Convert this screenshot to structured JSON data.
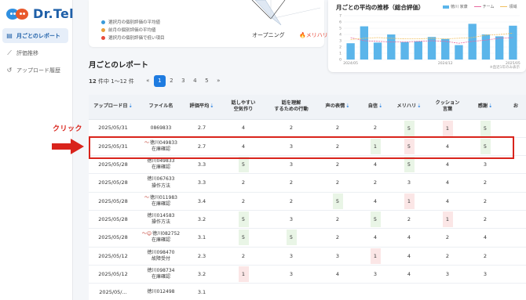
{
  "app": {
    "brand": "Dr.Tel"
  },
  "sidebar": {
    "items": [
      {
        "icon": "document-icon",
        "label": "月ごとのレポート",
        "active": true
      },
      {
        "icon": "trend-icon",
        "label": "評価推移",
        "active": false
      },
      {
        "icon": "history-icon",
        "label": "アップロード履歴",
        "active": false
      }
    ]
  },
  "top_card": {
    "legend": [
      {
        "color": "#3a9ad9",
        "text": "選択月の個別評価の平均値"
      },
      {
        "color": "#e8a03a",
        "text": "前月の個別評価の平均値"
      },
      {
        "color": "#e84a3a",
        "text": "選択月の個別評価で低い項目"
      }
    ],
    "radar_label_1": "オープニング",
    "radar_label_2": "メリハリ"
  },
  "trend_chart": {
    "title": "月ごとの平均の推移（総合評価）",
    "legend": {
      "self": "徳川 家康",
      "team": "チーム",
      "all": "領域"
    },
    "note": "※直近1年のみ表示",
    "colors": {
      "bar": "#5bb5ea",
      "team": "#e86aa0",
      "all": "#f0c060"
    }
  },
  "chart_data": {
    "type": "bar",
    "title": "月ごとの平均の推移（総合評価）",
    "x": [
      "2024/05",
      "2024/06",
      "2024/07",
      "2024/08",
      "2024/09",
      "2024/10",
      "2024/11",
      "2024/12",
      "2025/01",
      "2025/02",
      "2025/03",
      "2025/04",
      "2025/05"
    ],
    "tick_labels": [
      "2024/05",
      "2024/12",
      "2025/05"
    ],
    "ylim": [
      0,
      7
    ],
    "yticks": [
      0,
      1,
      2,
      3,
      4,
      5,
      6,
      7
    ],
    "series": [
      {
        "name": "徳川 家康",
        "type": "bar",
        "values": [
          2.6,
          5.3,
          2.7,
          4.0,
          2.8,
          2.9,
          3.6,
          3.3,
          2.3,
          5.7,
          4.0,
          3.7,
          5.4
        ]
      },
      {
        "name": "チーム",
        "type": "line",
        "values": [
          3.5,
          3.0,
          2.9,
          2.8,
          2.8,
          2.9,
          3.0,
          2.9,
          2.6,
          2.9,
          3.1,
          3.4,
          3.5
        ]
      },
      {
        "name": "領域",
        "type": "line",
        "values": [
          3.2,
          3.4,
          3.5,
          3.4,
          3.3,
          3.3,
          3.4,
          3.3,
          3.4,
          3.5,
          3.9,
          4.0,
          4.2
        ]
      }
    ]
  },
  "main": {
    "title": "月ごとのレポート",
    "pager": {
      "count_bold": "12",
      "count_rest": " 件中 1〜12 件",
      "prev": "«",
      "pages": [
        "1",
        "2",
        "3",
        "4",
        "5"
      ],
      "next": "»",
      "active": "1"
    },
    "columns": [
      [
        "アップロード日",
        "⇣"
      ],
      [
        "ファイル名",
        ""
      ],
      [
        "評価平均",
        "⇣"
      ],
      [
        "話しやすい",
        "空気作り"
      ],
      [
        "話を理解",
        "するための行動"
      ],
      [
        "声の表情",
        "⇣"
      ],
      [
        "自信",
        "⇣"
      ],
      [
        "メリハリ",
        "⇣"
      ],
      [
        "クッション",
        "言葉"
      ],
      [
        "感謝",
        "⇣"
      ],
      [
        "お",
        ""
      ]
    ],
    "rows": [
      {
        "date": "2025/05/31",
        "file": [
          "0869833"
        ],
        "mark": "",
        "avg": "2.7",
        "v": [
          "4",
          "2",
          "2",
          "2",
          "5",
          "1",
          "5",
          ""
        ],
        "c": [
          "",
          "",
          "",
          "",
          "g",
          "r",
          "g",
          ""
        ]
      },
      {
        "date": "2025/05/31",
        "file": [
          "徳川049833",
          "在庫確認"
        ],
        "mark": "〜",
        "avg": "2.7",
        "v": [
          "4",
          "3",
          "2",
          "1",
          "5",
          "4",
          "5",
          ""
        ],
        "c": [
          "",
          "",
          "",
          "g",
          "r",
          "",
          "g",
          ""
        ]
      },
      {
        "date": "2025/05/28",
        "file": [
          "徳川049833",
          "在庫確認"
        ],
        "mark": "",
        "avg": "3.3",
        "v": [
          "5",
          "3",
          "2",
          "4",
          "5",
          "4",
          "3",
          ""
        ],
        "c": [
          "g",
          "",
          "",
          "",
          "g",
          "",
          "",
          ""
        ]
      },
      {
        "date": "2025/05/28",
        "file": [
          "徳川067633",
          "操作方法"
        ],
        "mark": "",
        "avg": "3.3",
        "v": [
          "2",
          "2",
          "2",
          "2",
          "3",
          "4",
          "2",
          ""
        ],
        "c": [
          "",
          "",
          "",
          "",
          "",
          "",
          "",
          ""
        ]
      },
      {
        "date": "2025/05/28",
        "file": [
          "徳川011983",
          "在庫確認"
        ],
        "mark": "〜",
        "avg": "3.4",
        "v": [
          "2",
          "2",
          "5",
          "4",
          "1",
          "4",
          "2",
          ""
        ],
        "c": [
          "",
          "",
          "g",
          "",
          "r",
          "",
          "",
          ""
        ]
      },
      {
        "date": "2025/05/28",
        "file": [
          "徳川014583",
          "操作方法"
        ],
        "mark": "",
        "avg": "3.2",
        "v": [
          "5",
          "3",
          "2",
          "5",
          "2",
          "1",
          "2",
          ""
        ],
        "c": [
          "g",
          "",
          "",
          "g",
          "",
          "r",
          "",
          ""
        ]
      },
      {
        "date": "2025/05/28",
        "file": [
          "徳川082752",
          "在庫確認"
        ],
        "mark": "〜☺",
        "avg": "3.1",
        "v": [
          "5",
          "5",
          "2",
          "4",
          "4",
          "2",
          "4",
          ""
        ],
        "c": [
          "g",
          "g",
          "",
          "",
          "",
          "",
          "",
          ""
        ]
      },
      {
        "date": "2025/05/12",
        "file": [
          "徳川098470",
          "故障受付"
        ],
        "mark": "",
        "avg": "2.3",
        "v": [
          "2",
          "3",
          "3",
          "1",
          "4",
          "2",
          "2",
          ""
        ],
        "c": [
          "",
          "",
          "",
          "r",
          "",
          "",
          "",
          ""
        ]
      },
      {
        "date": "2025/05/12",
        "file": [
          "徳川098734",
          "在庫確認"
        ],
        "mark": "",
        "avg": "3.2",
        "v": [
          "1",
          "3",
          "4",
          "3",
          "4",
          "3",
          "3",
          ""
        ],
        "c": [
          "r",
          "",
          "",
          "",
          "",
          "",
          "",
          ""
        ]
      },
      {
        "date": "2025/05/...",
        "file": [
          "徳川012498"
        ],
        "mark": "",
        "avg": "3.1",
        "v": [
          "",
          "",
          "",
          "",
          "",
          "",
          "",
          ""
        ],
        "c": [
          "",
          "",
          "",
          "",
          "",
          "",
          "",
          ""
        ]
      }
    ]
  },
  "annotation": {
    "click_label": "クリック",
    "color": "#d9241c"
  }
}
